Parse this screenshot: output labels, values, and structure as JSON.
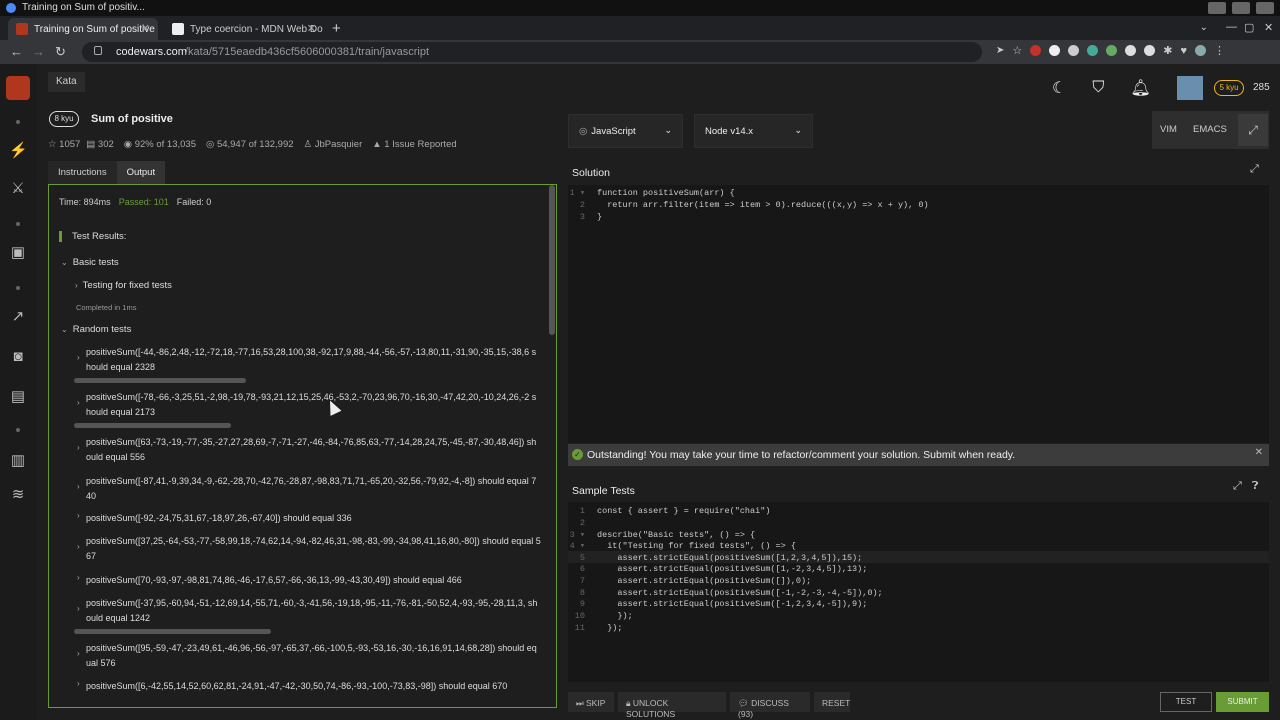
{
  "os": {
    "window_title": "Training on Sum of positiv..."
  },
  "browser": {
    "tabs": [
      {
        "label": "Training on Sum of positive",
        "active": true
      },
      {
        "label": "Type coercion - MDN Web Do",
        "active": false
      }
    ],
    "url_host": "codewars.com",
    "url_path": "/kata/5715eaedb436cf5606000381/train/javascript"
  },
  "header": {
    "section_tab": "Kata",
    "kyu": "8 kyu",
    "kata_title": "Sum of positive",
    "meta": {
      "stars": "1057",
      "collections": "302",
      "satisfaction": "92% of 13,035",
      "completed": "54,947 of 132,992",
      "author": "JbPasquier",
      "issues": "1 Issue Reported"
    },
    "user": {
      "rank": "5 kyu",
      "honor": "285"
    }
  },
  "left_panel": {
    "tabs": [
      "Instructions",
      "Output"
    ],
    "summary": {
      "time": "Time: 894ms",
      "passed": "Passed: 101",
      "failed": "Failed: 0"
    },
    "results_heading": "Test Results:",
    "basic_group": "Basic tests",
    "fixed_tests": "Testing for fixed tests",
    "completed_note": "Completed in 1ms",
    "random_group": "Random tests",
    "random_items": [
      "positiveSum([-44,-86,2,48,-12,-72,18,-77,16,53,28,100,38,-92,17,9,88,-44,-56,-57,-13,80,11,-31,90,-35,15,-38,6 should equal 2328",
      "positiveSum([-78,-66,-3,25,51,-2,98,-19,78,-93,21,12,15,25,46,-53,2,-70,23,96,70,-16,30,-47,42,20,-10,24,26,-2 should equal 2173",
      "positiveSum([63,-73,-19,-77,-35,-27,27,28,69,-7,-71,-27,-46,-84,-76,85,63,-77,-14,28,24,75,-45,-87,-30,48,46]) should equal 556",
      "positiveSum([-87,41,-9,39,34,-9,-62,-28,70,-42,76,-28,87,-98,83,71,71,-65,20,-32,56,-79,92,-4,-8]) should equal 740",
      "positiveSum([-92,-24,75,31,67,-18,97,26,-67,40]) should equal 336",
      "positiveSum([37,25,-64,-53,-77,-58,99,18,-74,62,14,-94,-82,46,31,-98,-83,-99,-34,98,41,16,80,-80]) should equal 567",
      "positiveSum([70,-93,-97,-98,81,74,86,-46,-17,6,57,-66,-36,13,-99,-43,30,49]) should equal 466",
      "positiveSum([-37,95,-60,94,-51,-12,69,14,-55,71,-60,-3,-41,56,-19,18,-95,-11,-76,-81,-50,52,4,-93,-95,-28,11,3, should equal 1242",
      "positiveSum([95,-59,-47,-23,49,61,-46,96,-56,-97,-65,37,-66,-100,5,-93,-53,16,-30,-16,16,91,14,68,28]) should equal 576",
      "positiveSum([6,-42,55,14,52,60,62,81,-24,91,-47,-42,-30,50,74,-86,-93,-100,-73,83,-98]) should equal 670"
    ]
  },
  "selectors": {
    "language": "JavaScript",
    "version": "Node v14.x"
  },
  "modes": {
    "vim": "VIM",
    "emacs": "EMACS"
  },
  "solution": {
    "label": "Solution",
    "lines": [
      "function positiveSum(arr) {",
      "  return arr.filter(item => item > 0).reduce(((x,y) => x + y), 0)",
      "}"
    ]
  },
  "success_message": "Outstanding! You may take your time to refactor/comment your solution. Submit when ready.",
  "sample_tests": {
    "label": "Sample Tests",
    "lines": [
      "const { assert } = require(\"chai\")",
      "",
      "describe(\"Basic tests\", () => {",
      "  it(\"Testing for fixed tests\", () => {",
      "    assert.strictEqual(positiveSum([1,2,3,4,5]),15);",
      "    assert.strictEqual(positiveSum([1,-2,3,4,5]),13);",
      "    assert.strictEqual(positiveSum([]),0);",
      "    assert.strictEqual(positiveSum([-1,-2,-3,-4,-5]),0);",
      "    assert.strictEqual(positiveSum([-1,2,3,4,-5]),9);",
      "    });",
      "  });"
    ]
  },
  "actions": {
    "skip": "SKIP",
    "unlock": "UNLOCK SOLUTIONS",
    "discuss": "DISCUSS (93)",
    "reset": "RESET",
    "test": "TEST",
    "submit": "SUBMIT"
  },
  "colors": {
    "accent_green": "#6a9c36",
    "brand_red": "#b1361e",
    "rank_yellow": "#ecb613"
  }
}
